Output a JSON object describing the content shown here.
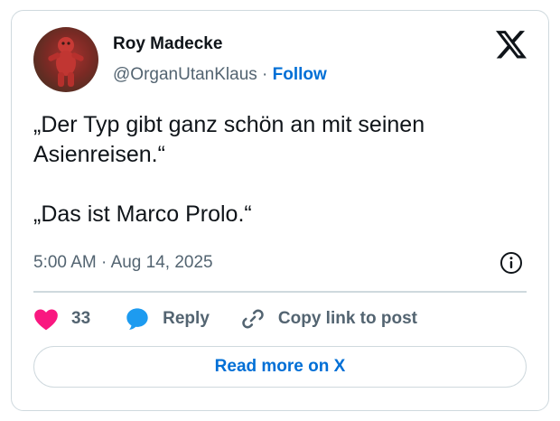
{
  "author": {
    "name": "Roy Madecke",
    "handle": "@OrganUtanKlaus",
    "separator": "·",
    "follow_label": "Follow"
  },
  "post": {
    "text": "„Der Typ gibt ganz schön an mit seinen Asienreisen.“\n\n„Das ist Marco Prolo.“",
    "time": "5:00 AM",
    "separator": "·",
    "date": "Aug 14, 2025"
  },
  "actions": {
    "like_count": "33",
    "reply_label": "Reply",
    "copy_label": "Copy link to post"
  },
  "read_more_label": "Read more on X",
  "icons": {
    "brand": "x-logo-icon",
    "info": "info-icon",
    "like": "heart-icon",
    "reply": "speech-bubble-icon",
    "copy": "link-icon"
  },
  "colors": {
    "heart": "#f91880",
    "reply_bubble": "#1d9bf0",
    "link_blue": "#006fd6",
    "muted_text": "#536471",
    "border": "#cfd9de"
  }
}
